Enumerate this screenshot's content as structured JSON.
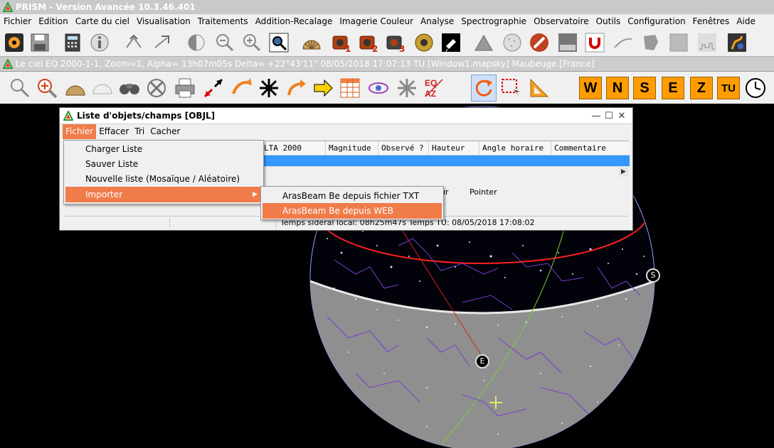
{
  "app": {
    "title": "PRISM - Version Avancée  10.3.46.401"
  },
  "menu": [
    "Fichier",
    "Edition",
    "Carte du ciel",
    "Visualisation",
    "Traitements",
    "Addition-Recalage",
    "Imagerie Couleur",
    "Analyse",
    "Spectrographie",
    "Observatoire",
    "Outils",
    "Configuration",
    "Fenêtres",
    "Aide"
  ],
  "child_window": {
    "title": "Le ciel EQ.2000-1-1, Zoom=1, Alpha= 13h07m05s Delta= +22°43'11\"     08/05/2018 17:07:13 TU [Window1.mapsky]   Maubeuge [France]"
  },
  "direction_buttons": [
    "W",
    "N",
    "S",
    "E",
    "Z",
    "TU"
  ],
  "toolbar2_text": {
    "eq_az": "EQ AZ"
  },
  "toolbar1_badges": [
    "1",
    "2",
    "3"
  ],
  "dialog": {
    "title": "Liste d'objets/champs [OBJL]",
    "menu": [
      "Fichier",
      "Effacer",
      "Tri",
      "Cacher"
    ],
    "columns": [
      "LTA 2000",
      "Magnitude",
      "Observé ?",
      "Hauteur",
      "Angle horaire",
      "Commentaire"
    ],
    "buttons_partial": [
      "ur",
      "Pointer"
    ],
    "status_text": "Temps sidéral local: 08h25m47s  Temps TU: 08/05/2018 17:08:02"
  },
  "fichier_menu": {
    "items": [
      "Charger Liste",
      "Sauver Liste",
      "Nouvelle liste (Mosaïque / Aléatoire)",
      "Importer"
    ]
  },
  "importer_menu": {
    "items": [
      "ArasBeam Be depuis fichier TXT",
      "ArasBeam Be depuis WEB"
    ]
  },
  "sky_labels": {
    "south": "S",
    "east": "E"
  },
  "colors": {
    "menu_highlight": "#f07c4a",
    "grid_selection": "#3399ff",
    "direction_button": "#ff9c00",
    "horizon": "#ff2020"
  }
}
